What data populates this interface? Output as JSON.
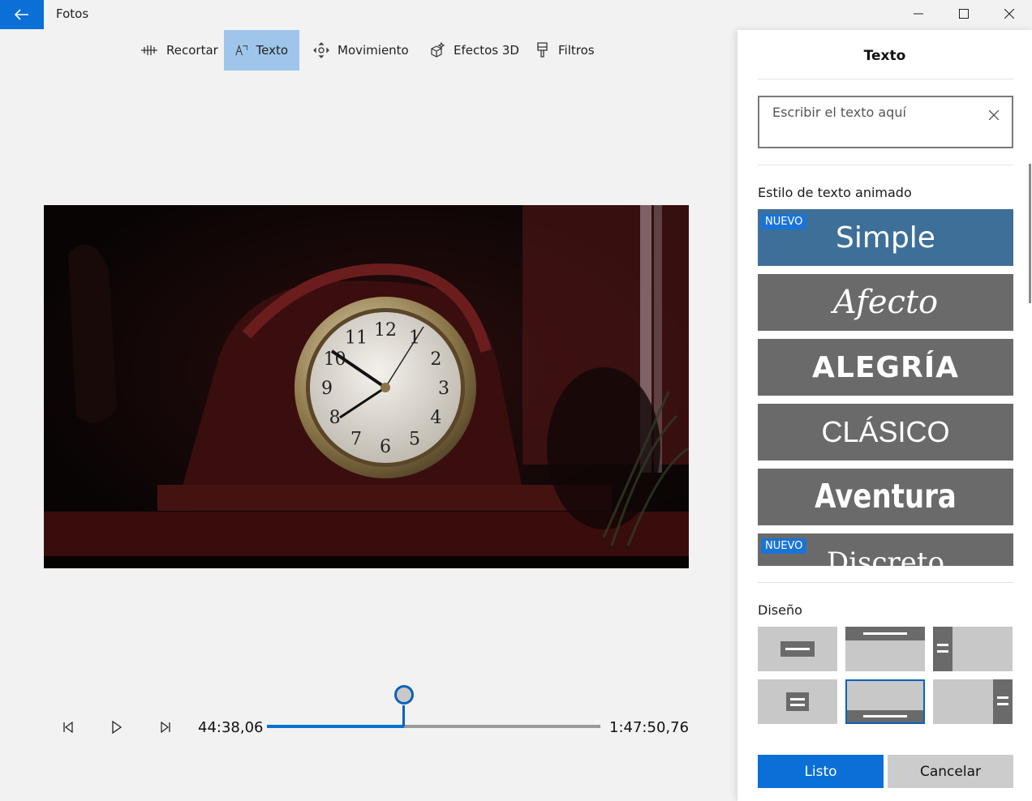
{
  "window": {
    "app_title": "Fotos"
  },
  "toolbar": {
    "items": [
      {
        "label": "Recortar",
        "icon": "trim-icon"
      },
      {
        "label": "Texto",
        "icon": "text-icon"
      },
      {
        "label": "Movimiento",
        "icon": "motion-icon"
      },
      {
        "label": "Efectos 3D",
        "icon": "3d-effects-icon"
      },
      {
        "label": "Filtros",
        "icon": "filters-icon"
      }
    ],
    "active": "Texto"
  },
  "video": {
    "clock_numbers": [
      "12",
      "1",
      "2",
      "3",
      "4",
      "5",
      "6",
      "7",
      "8",
      "9",
      "10",
      "11"
    ]
  },
  "playback": {
    "current_time": "44:38,06",
    "total_time": "1:47:50,76",
    "progress": 0.41
  },
  "panel": {
    "title": "Texto",
    "text_input": {
      "value": "",
      "placeholder": "Escribir el texto aquí"
    },
    "animated_style_label": "Estilo de texto animado",
    "styles": [
      {
        "label": "Simple",
        "badge": "NUEVO",
        "selected": true
      },
      {
        "label": "Afecto",
        "badge": "",
        "selected": false
      },
      {
        "label": "ALEGRÍA",
        "badge": "",
        "selected": false
      },
      {
        "label": "CLÁSICO",
        "badge": "",
        "selected": false
      },
      {
        "label": "Aventura",
        "badge": "",
        "selected": false
      },
      {
        "label": "Discreto",
        "badge": "NUEVO",
        "selected": false
      }
    ],
    "layout_label": "Diseño",
    "selected_layout": 4,
    "done_label": "Listo",
    "cancel_label": "Cancelar"
  },
  "colors": {
    "accent": "#0a6fd6",
    "selected_style": "#3d6f99",
    "style_tile": "#6a6a6a",
    "active_tool": "#9fc6ea"
  }
}
